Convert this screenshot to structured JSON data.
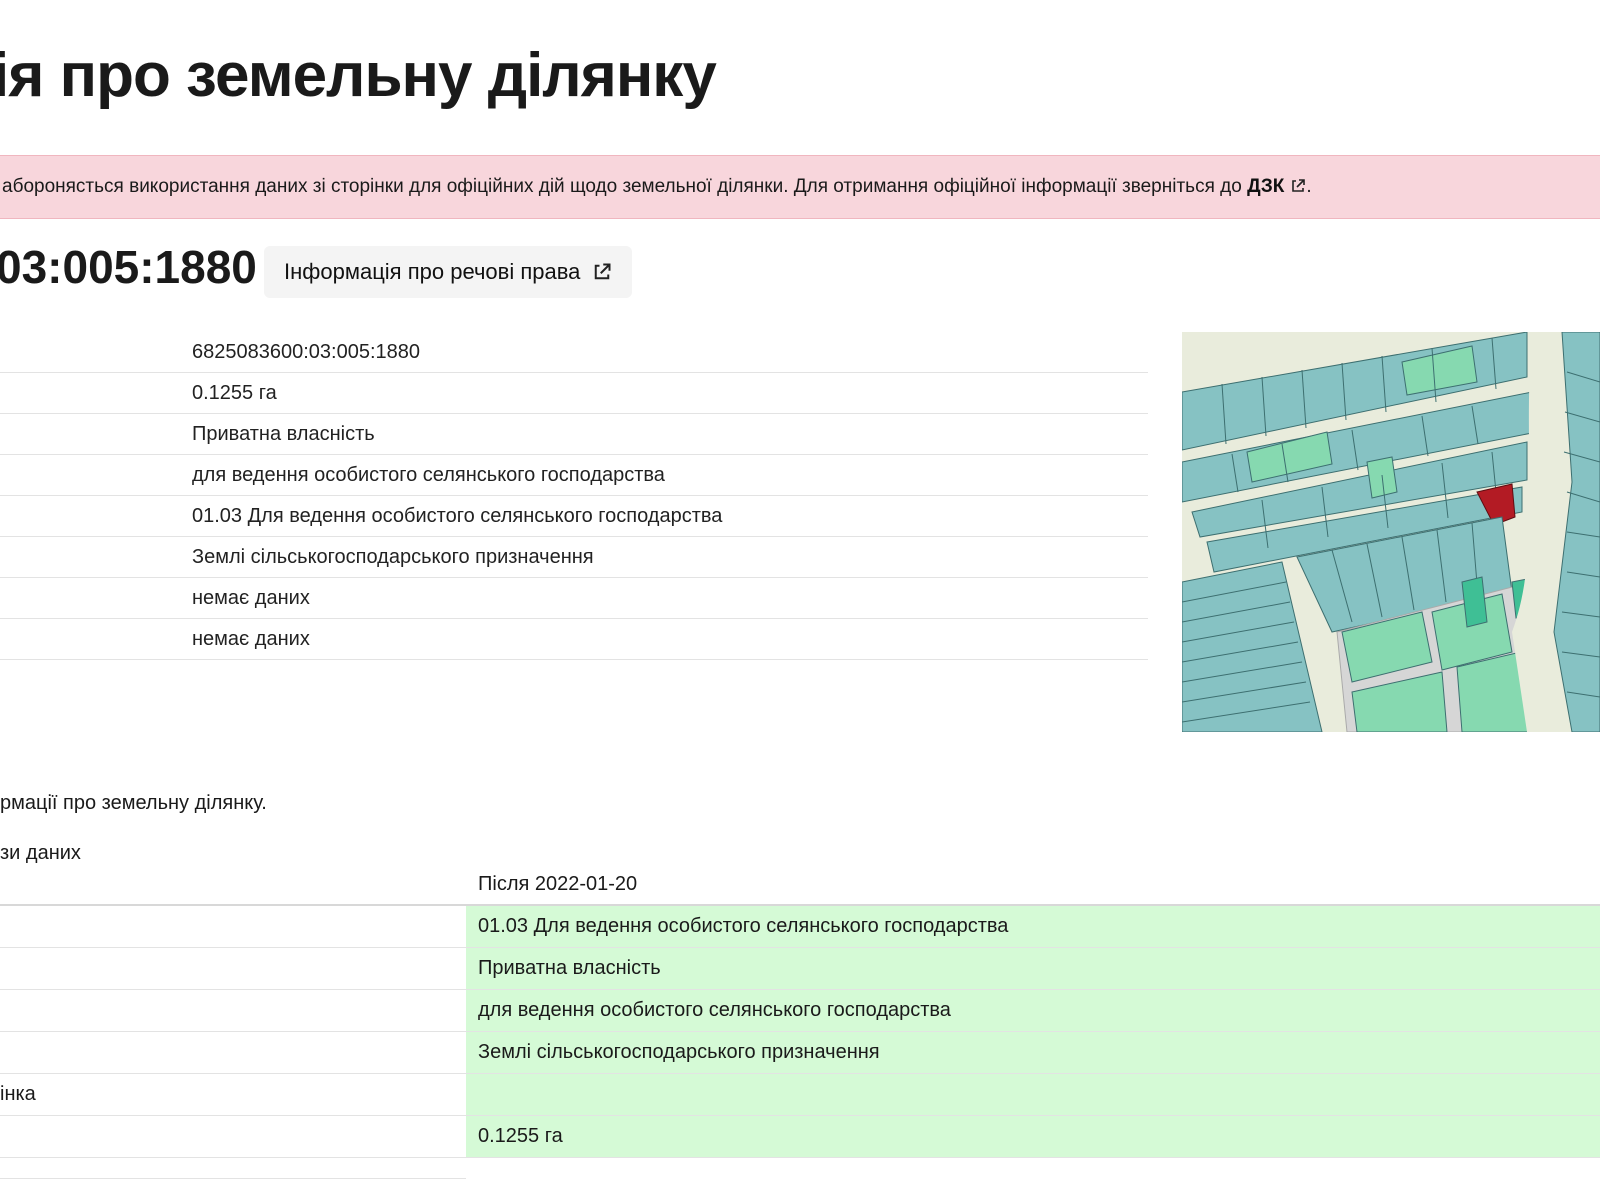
{
  "page": {
    "title": "ія про земельну ділянку"
  },
  "alert": {
    "text": "аборонясться використання даних зі сторінки для офіційних дій щодо земельної ділянки. Для отримання офіційної інформації зверніться до ",
    "link_label": "ДЗК",
    "trailing": "."
  },
  "parcel": {
    "number_partial": "03:005:1880",
    "rights_button_label": "Інформація про речові права"
  },
  "info_rows": [
    {
      "value": "6825083600:03:005:1880"
    },
    {
      "value": "0.1255 га"
    },
    {
      "value": "Приватна власність"
    },
    {
      "value": "для ведення особистого селянського господарства"
    },
    {
      "value": "01.03 Для ведення особистого селянського господарства"
    },
    {
      "value": "Землі сільськогосподарського призначення"
    },
    {
      "value": "немає даних"
    },
    {
      "value": "немає даних"
    }
  ],
  "map": {
    "highlight_color": "#b31b24",
    "parcel_color": "#86c2c3",
    "road_color": "#e9ecdc"
  },
  "history": {
    "note": "рмації про земельну ділянку.",
    "section_label": "зи даних",
    "column_header": "Після 2022-01-20",
    "rows": [
      {
        "label": "",
        "value": "01.03 Для ведення особистого селянського господарства"
      },
      {
        "label": "",
        "value": "Приватна власність"
      },
      {
        "label": "",
        "value": "для ведення особистого селянського господарства"
      },
      {
        "label": "",
        "value": "Землі сільськогосподарського призначення"
      },
      {
        "label": "інка",
        "value": ""
      },
      {
        "label": "",
        "value": "0.1255 га"
      }
    ],
    "highlight_color": "#d5fad6"
  }
}
